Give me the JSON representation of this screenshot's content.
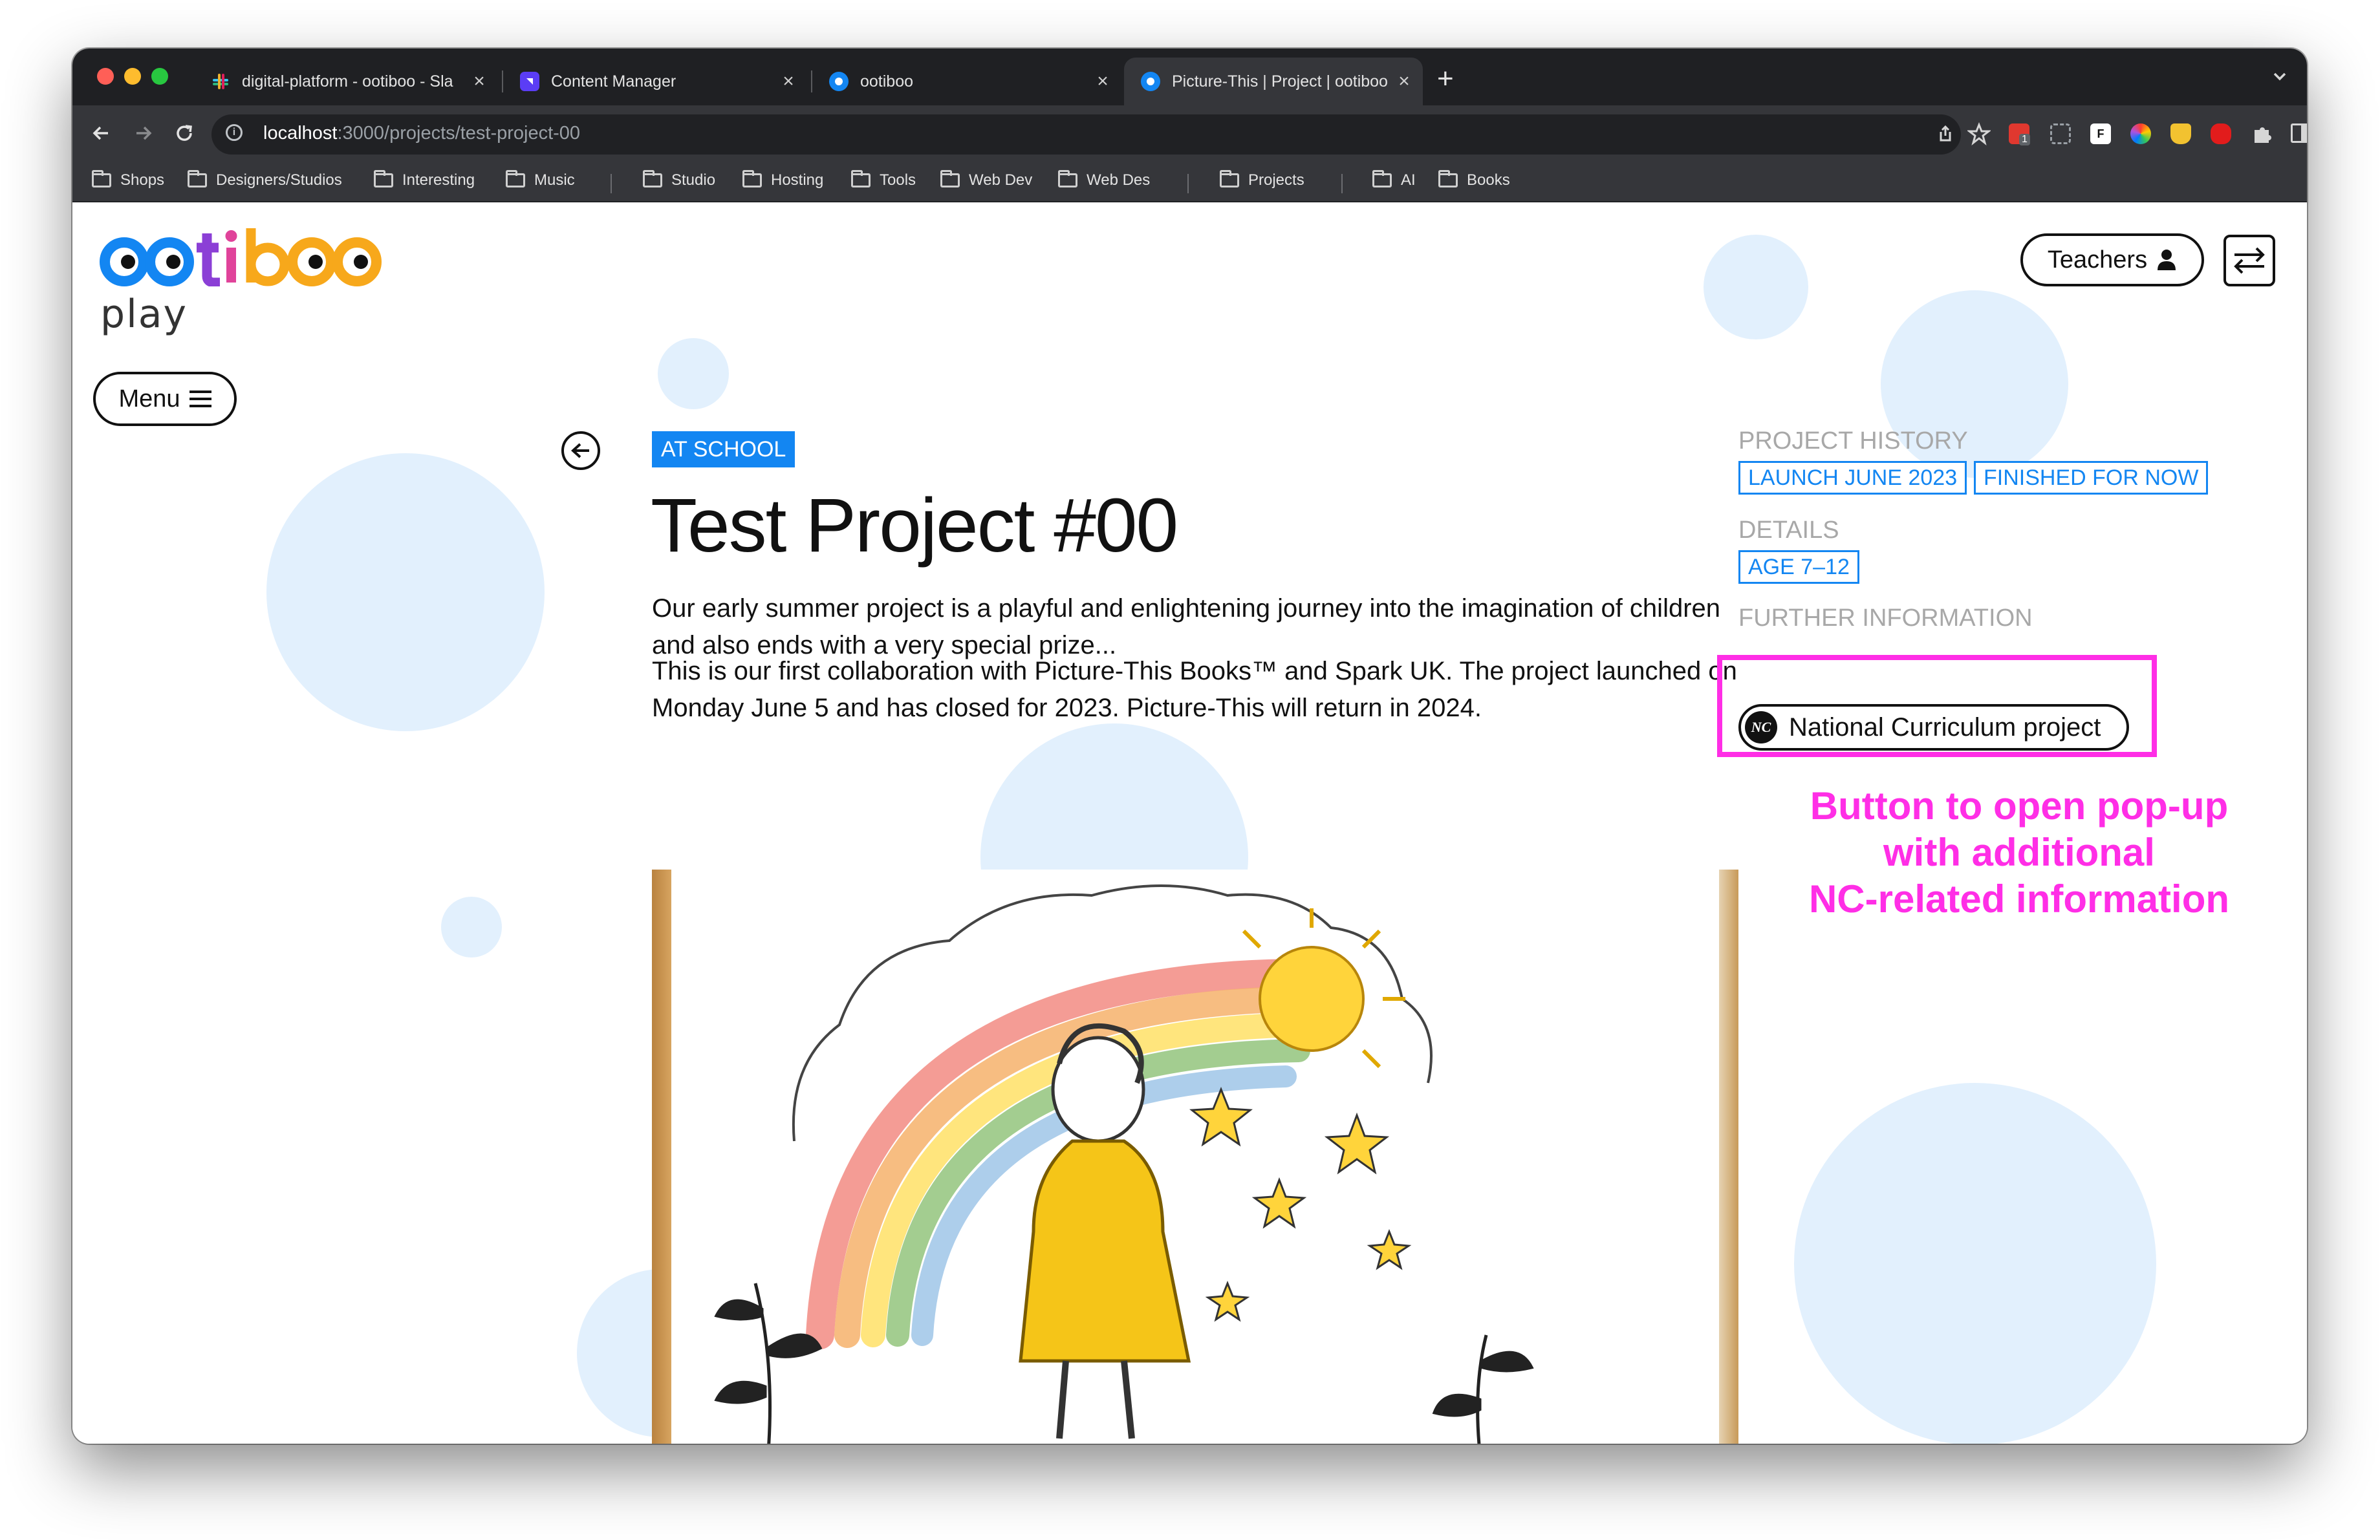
{
  "browser": {
    "tabs": [
      {
        "title": "digital-platform - ootiboo - Sla",
        "active": false
      },
      {
        "title": "Content Manager",
        "active": false
      },
      {
        "title": "ootiboo",
        "active": false
      },
      {
        "title": "Picture-This | Project | ootiboo",
        "active": true
      }
    ],
    "new_tab": "+",
    "tab_close": "×",
    "url_host": "localhost",
    "url_rest": ":3000/projects/test-project-00",
    "bookmarks": [
      "Shops",
      "Designers/Studios",
      "Interesting",
      "Music",
      "Studio",
      "Hosting",
      "Tools",
      "Web Dev",
      "Web Des",
      "Projects",
      "AI",
      "Books"
    ],
    "extension_badge": "1"
  },
  "site": {
    "logo_text": "ootiboo",
    "logo_subtext": "play",
    "logo_colors": {
      "o": "#1386f2",
      "t": "#8b3fd6",
      "i": "#f7a81b",
      "b": "#f7a81b"
    },
    "teachers_label": "Teachers",
    "menu_label": "Menu"
  },
  "project": {
    "tag": "AT SCHOOL",
    "title": "Test Project #00",
    "paragraph1": "Our early summer project is a playful and enlightening journey into the imagination of children and also ends with a very special prize...",
    "paragraph2": "This is our first collaboration with Picture-This Books™ and Spark UK. The project launched on Monday June 5 and has closed for 2023. Picture-This will return in 2024."
  },
  "sidebar": {
    "history_heading": "PROJECT HISTORY",
    "history_chips": [
      "LAUNCH JUNE 2023",
      "FINISHED FOR NOW"
    ],
    "details_heading": "DETAILS",
    "details_chips": [
      "AGE 7–12"
    ],
    "further_heading": "FURTHER INFORMATION",
    "nc_logo_text": "NC",
    "nc_button_label": "National Curriculum project"
  },
  "annotation": {
    "lines": [
      "Button to open pop-up",
      "with additional",
      "NC-related information"
    ],
    "color": "#ff2ee6"
  },
  "colors": {
    "accent_blue": "#1386f2",
    "bubble": "#e2f0fd"
  }
}
